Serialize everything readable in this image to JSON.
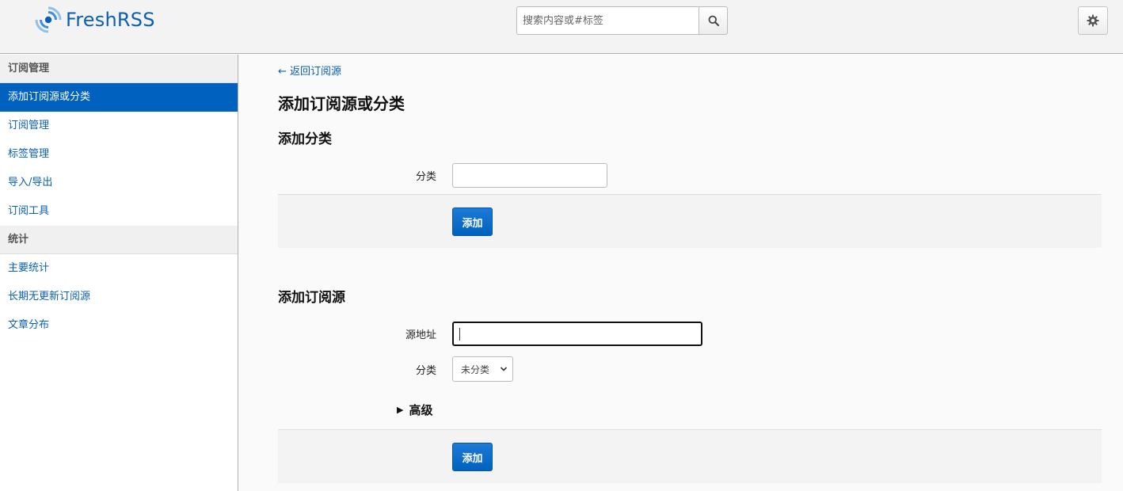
{
  "header": {
    "app_name": "FreshRSS",
    "search_placeholder": "搜索内容或#标签",
    "icons": {
      "search": "search-icon",
      "settings": "gear-icon",
      "logo": "freshrss-logo-icon"
    }
  },
  "sidebar": {
    "groups": [
      {
        "title": "订阅管理",
        "items": [
          {
            "label": "添加订阅源或分类",
            "active": true
          },
          {
            "label": "订阅管理",
            "active": false
          },
          {
            "label": "标签管理",
            "active": false
          },
          {
            "label": "导入/导出",
            "active": false
          },
          {
            "label": "订阅工具",
            "active": false
          }
        ]
      },
      {
        "title": "统计",
        "items": [
          {
            "label": "主要统计",
            "active": false
          },
          {
            "label": "长期无更新订阅源",
            "active": false
          },
          {
            "label": "文章分布",
            "active": false
          }
        ]
      }
    ]
  },
  "main": {
    "back_link": "← 返回订阅源",
    "page_title": "添加订阅源或分类",
    "add_category": {
      "title": "添加分类",
      "category_label": "分类",
      "category_value": "",
      "submit_label": "添加"
    },
    "add_feed": {
      "title": "添加订阅源",
      "url_label": "源地址",
      "url_value": "",
      "category_label": "分类",
      "category_selected": "未分类",
      "advanced_label": "高级",
      "submit_label": "添加"
    }
  },
  "colors": {
    "accent": "#0062be",
    "link": "#0b5fb3",
    "header_bg": "#f3f3f3"
  }
}
